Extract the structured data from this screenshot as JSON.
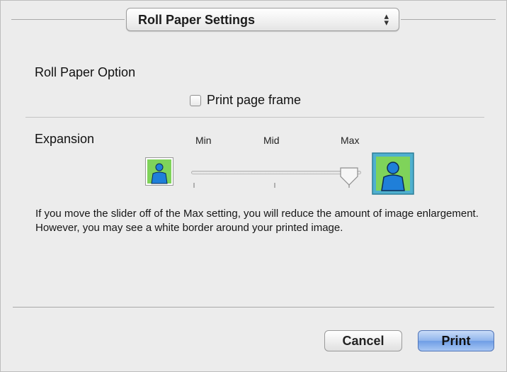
{
  "settings_popup": {
    "selected": "Roll Paper Settings",
    "arrows_icon": "up-down-arrows-icon"
  },
  "roll_paper": {
    "heading": "Roll Paper Option",
    "print_frame_label": "Print page frame",
    "print_frame_checked": false
  },
  "expansion": {
    "heading": "Expansion",
    "ticks": [
      "Min",
      "Mid",
      "Max"
    ],
    "level": "Max",
    "level_fraction": 1.0,
    "min_icon": "small-image-icon",
    "max_icon": "large-image-icon",
    "description": "If you move the slider off of the Max setting, you will reduce the amount of image enlargement. However, you may see a white border around your printed image."
  },
  "buttons": {
    "cancel": "Cancel",
    "print": "Print"
  },
  "colors": {
    "image_bg": "#7fd35a",
    "image_figure": "#1f7fd9",
    "print_button": "#7fa8ec"
  }
}
